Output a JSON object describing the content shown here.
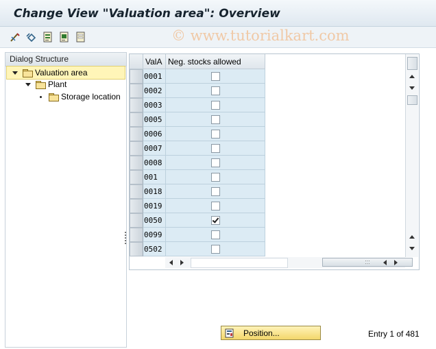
{
  "window": {
    "title": "Change View \"Valuation area\": Overview"
  },
  "watermark": "© www.tutorialkart.com",
  "toolbar": {
    "icons": [
      "change-display-icon",
      "undo-icon",
      "select-all-icon",
      "select-block-icon",
      "deselect-all-icon"
    ]
  },
  "dialog_structure": {
    "header": "Dialog Structure",
    "items": [
      {
        "label": "Valuation area",
        "level": 0,
        "expanded": true,
        "selected": true
      },
      {
        "label": "Plant",
        "level": 1,
        "expanded": true,
        "selected": false
      },
      {
        "label": "Storage location",
        "level": 2,
        "expanded": false,
        "selected": false
      }
    ]
  },
  "table": {
    "columns": [
      "ValA",
      "Neg. stocks allowed"
    ],
    "rows": [
      {
        "vala": "0001",
        "neg": false
      },
      {
        "vala": "0002",
        "neg": false
      },
      {
        "vala": "0003",
        "neg": false
      },
      {
        "vala": "0005",
        "neg": false
      },
      {
        "vala": "0006",
        "neg": false
      },
      {
        "vala": "0007",
        "neg": false
      },
      {
        "vala": "0008",
        "neg": false
      },
      {
        "vala": "001",
        "neg": false
      },
      {
        "vala": "0018",
        "neg": false
      },
      {
        "vala": "0019",
        "neg": false
      },
      {
        "vala": "0050",
        "neg": true
      },
      {
        "vala": "0099",
        "neg": false
      },
      {
        "vala": "0502",
        "neg": false
      }
    ],
    "scroll_grip": ":::"
  },
  "footer": {
    "position_button": "Position...",
    "entry_text": "Entry 1 of 481"
  },
  "colors": {
    "accent": "#f3d76b",
    "selected_row": "#fff5b8",
    "cell_bg": "#dcebf4"
  }
}
